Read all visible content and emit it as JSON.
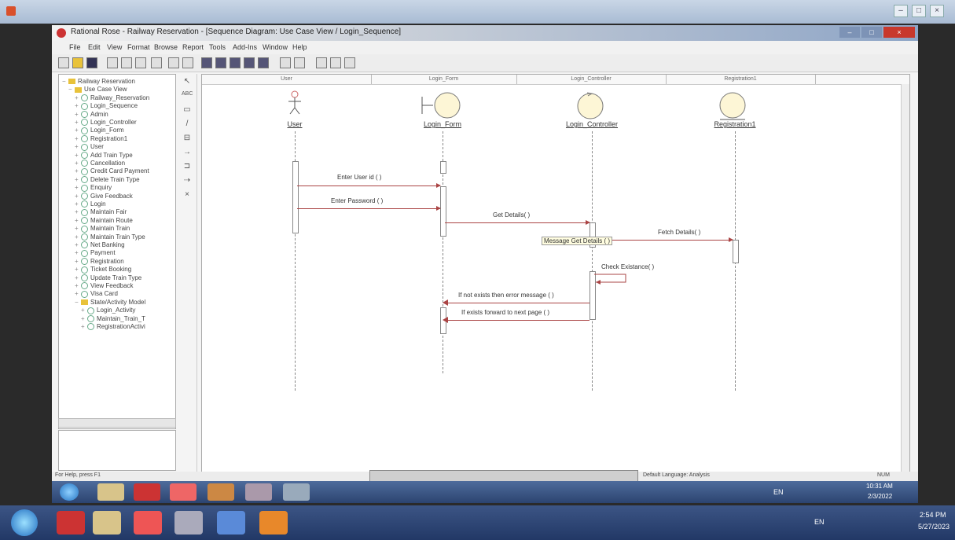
{
  "outer": {
    "taskbar": {
      "lang": "EN",
      "time": "2:54 PM",
      "date": "5/27/2023"
    }
  },
  "app": {
    "title": "Rational Rose - Railway Reservation - [Sequence Diagram: Use Case View / Login_Sequence]",
    "menu": [
      "File",
      "Edit",
      "View",
      "Format",
      "Browse",
      "Report",
      "Tools",
      "Add-Ins",
      "Window",
      "Help"
    ],
    "status_left": "For Help, press F1",
    "status_mid": "Default Language: Analysis",
    "status_right": "NUM"
  },
  "browser": {
    "items": [
      {
        "label": "Railway Reservation",
        "depth": 0,
        "kind": "root"
      },
      {
        "label": "Use Case View",
        "depth": 1,
        "kind": "folder"
      },
      {
        "label": "Railway_Reservation",
        "depth": 2,
        "kind": "diagram"
      },
      {
        "label": "Login_Sequence",
        "depth": 2,
        "kind": "diagram"
      },
      {
        "label": "Admin",
        "depth": 2,
        "kind": "actor"
      },
      {
        "label": "Login_Controller",
        "depth": 2,
        "kind": "class"
      },
      {
        "label": "Login_Form",
        "depth": 2,
        "kind": "class"
      },
      {
        "label": "Registration1",
        "depth": 2,
        "kind": "class"
      },
      {
        "label": "User",
        "depth": 2,
        "kind": "actor"
      },
      {
        "label": "Add Train Type",
        "depth": 2,
        "kind": "usecase"
      },
      {
        "label": "Cancellation",
        "depth": 2,
        "kind": "usecase"
      },
      {
        "label": "Credit Card Payment",
        "depth": 2,
        "kind": "usecase"
      },
      {
        "label": "Delete Train Type",
        "depth": 2,
        "kind": "usecase"
      },
      {
        "label": "Enquiry",
        "depth": 2,
        "kind": "usecase"
      },
      {
        "label": "Give Feedback",
        "depth": 2,
        "kind": "usecase"
      },
      {
        "label": "Login",
        "depth": 2,
        "kind": "usecase"
      },
      {
        "label": "Maintain Fair",
        "depth": 2,
        "kind": "usecase"
      },
      {
        "label": "Maintain Route",
        "depth": 2,
        "kind": "usecase"
      },
      {
        "label": "Maintain Train",
        "depth": 2,
        "kind": "usecase"
      },
      {
        "label": "Maintain Train Type",
        "depth": 2,
        "kind": "usecase"
      },
      {
        "label": "Net Banking",
        "depth": 2,
        "kind": "usecase"
      },
      {
        "label": "Payment",
        "depth": 2,
        "kind": "usecase"
      },
      {
        "label": "Registration",
        "depth": 2,
        "kind": "usecase"
      },
      {
        "label": "Ticket Booking",
        "depth": 2,
        "kind": "usecase"
      },
      {
        "label": "Update Train Type",
        "depth": 2,
        "kind": "usecase"
      },
      {
        "label": "View Feedback",
        "depth": 2,
        "kind": "usecase"
      },
      {
        "label": "Visa Card",
        "depth": 2,
        "kind": "usecase"
      },
      {
        "label": "State/Activity Model",
        "depth": 2,
        "kind": "folder"
      },
      {
        "label": "Login_Activity",
        "depth": 3,
        "kind": "activity"
      },
      {
        "label": "Maintain_Train_T",
        "depth": 3,
        "kind": "activity"
      },
      {
        "label": "RegistrationActivi",
        "depth": 3,
        "kind": "activity"
      }
    ]
  },
  "diagram": {
    "headers": [
      "User",
      "Login_Form",
      "Login_Controller",
      "Registration1"
    ],
    "objects": [
      "User",
      "Login_Form",
      "Login_Controller",
      "Registration1"
    ],
    "messages": [
      {
        "label": "Enter User id ( )"
      },
      {
        "label": "Enter Password ( )"
      },
      {
        "label": "Get Details( )"
      },
      {
        "label": "Fetch Details( )"
      },
      {
        "label": "Message Get Details ( )"
      },
      {
        "label": "Check Existance( )"
      },
      {
        "label": "If not exists then error message ( )"
      },
      {
        "label": "If exists forward to next page ( )"
      }
    ]
  },
  "inner_taskbar": {
    "time": "10:31 AM",
    "date": "2/3/2022",
    "lang": "EN"
  }
}
